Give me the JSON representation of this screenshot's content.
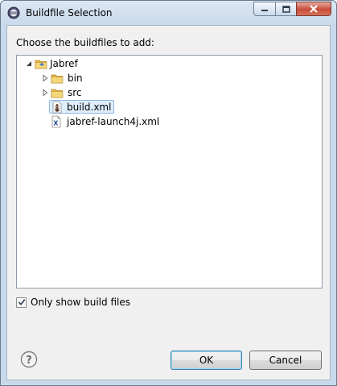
{
  "window": {
    "title": "Buildfile Selection"
  },
  "prompt": "Choose the buildfiles to add:",
  "tree": {
    "root": {
      "label": "Jabref",
      "expanded": true
    },
    "children": [
      {
        "label": "bin",
        "type": "folder",
        "expandable": true
      },
      {
        "label": "src",
        "type": "folder",
        "expandable": true
      },
      {
        "label": "build.xml",
        "type": "ant-file",
        "selected": true
      },
      {
        "label": "jabref-launch4j.xml",
        "type": "xml-file",
        "selected": false
      }
    ]
  },
  "filter": {
    "label": "Only show build files",
    "checked": true
  },
  "buttons": {
    "ok": "OK",
    "cancel": "Cancel"
  },
  "colors": {
    "selection_bg": "#dfeefc",
    "selection_border": "#8fb8e6",
    "folder": "#e8b84a"
  }
}
